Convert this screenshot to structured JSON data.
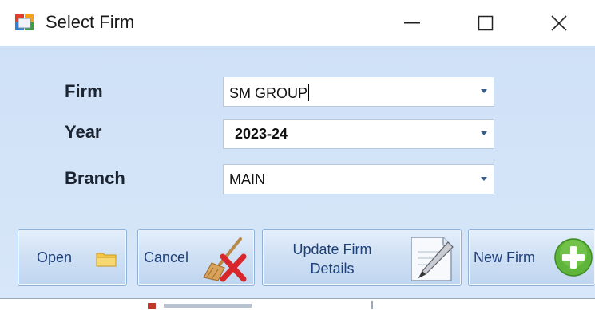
{
  "window": {
    "title": "Select Firm",
    "icons": {
      "app": "app-window-icon",
      "minimize": "minimize-icon",
      "maximize": "maximize-icon",
      "close": "close-icon"
    }
  },
  "form": {
    "firm": {
      "label": "Firm",
      "value": "SM GROUP"
    },
    "year": {
      "label": "Year",
      "value": "2023-24"
    },
    "branch": {
      "label": "Branch",
      "value": "MAIN"
    }
  },
  "buttons": {
    "open": {
      "label": "Open",
      "icon": "folder-icon"
    },
    "cancel": {
      "label": "Cancel",
      "icon": "broom-cross-icon"
    },
    "update": {
      "label": "Update Firm Details",
      "icon": "edit-document-icon"
    },
    "new_firm": {
      "label": "New Firm",
      "icon": "plus-circle-icon"
    }
  },
  "colors": {
    "client_bg": "#cfe1f7",
    "button_text": "#1d3f7a",
    "label_text": "#1b2430"
  }
}
